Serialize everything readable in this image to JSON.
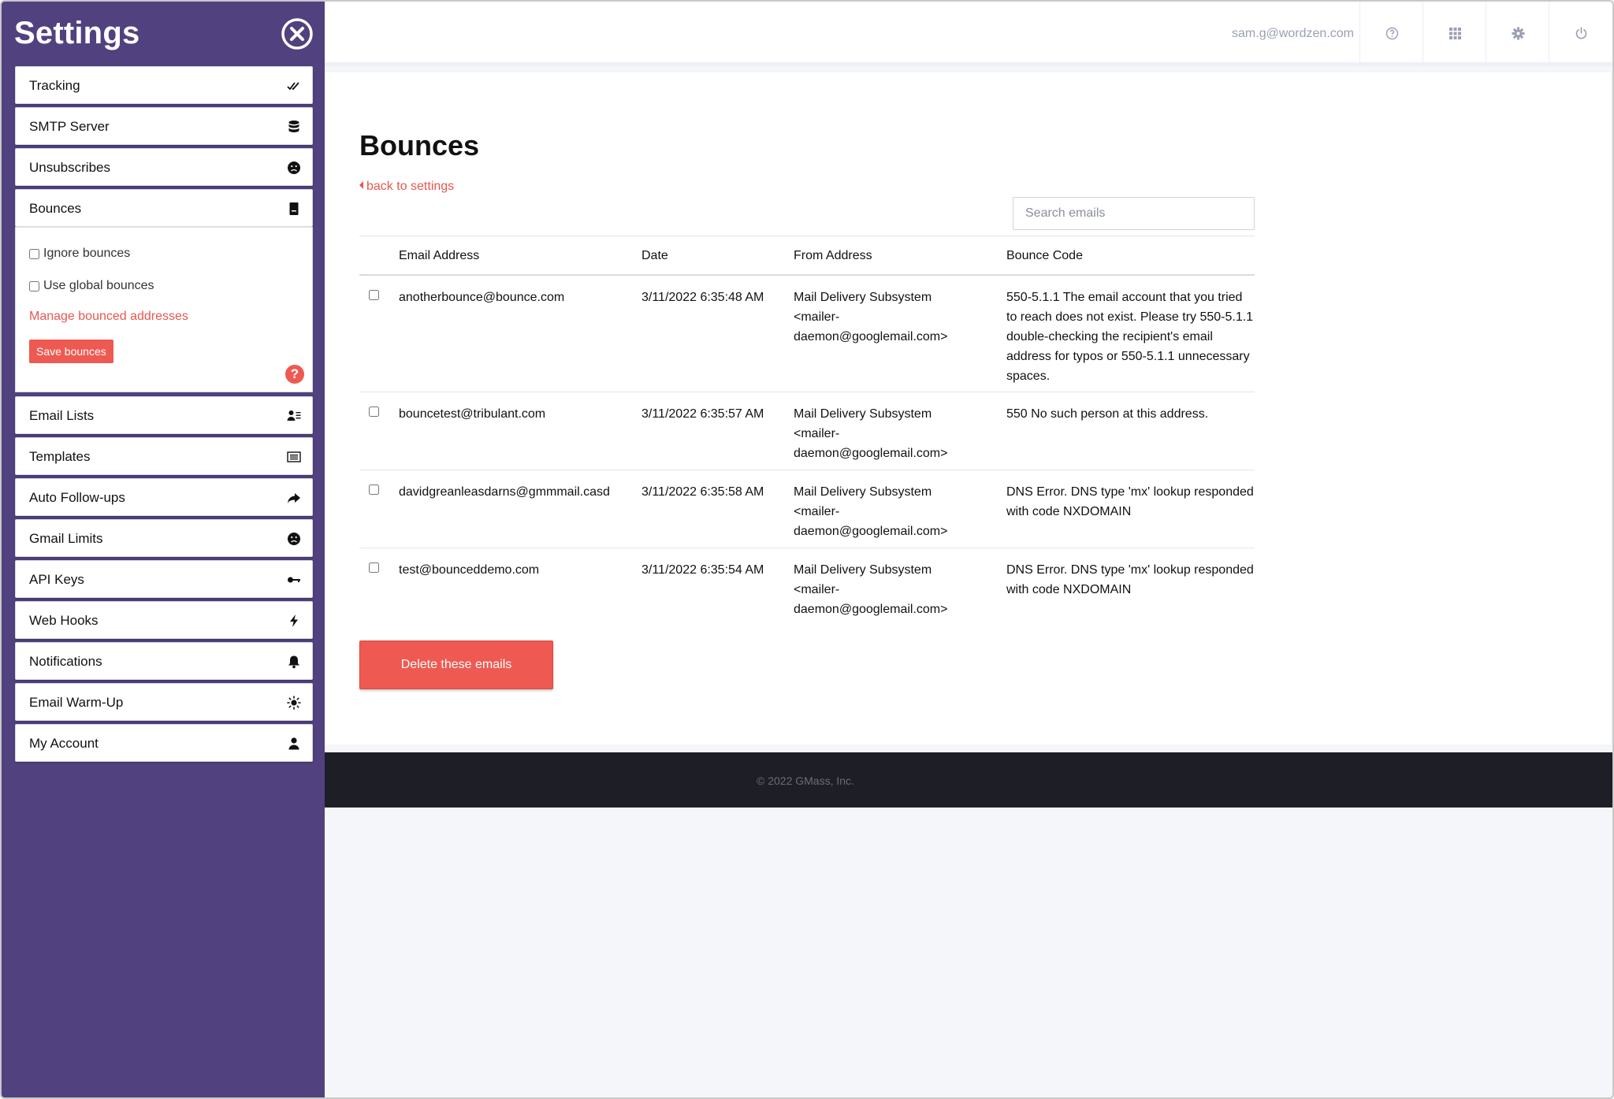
{
  "sidebar": {
    "title": "Settings",
    "items_before": [
      {
        "label": "Tracking",
        "icon": "double-check-icon"
      },
      {
        "label": "SMTP Server",
        "icon": "database-icon"
      },
      {
        "label": "Unsubscribes",
        "icon": "sad-face-icon"
      },
      {
        "label": "Bounces",
        "icon": "document-icon"
      }
    ],
    "bounces_panel": {
      "ignore_label": "Ignore bounces",
      "global_label": "Use global bounces",
      "manage_link": "Manage bounced addresses",
      "save_label": "Save bounces",
      "help_label": "?"
    },
    "items_after": [
      {
        "label": "Email Lists",
        "icon": "users-list-icon"
      },
      {
        "label": "Templates",
        "icon": "template-icon"
      },
      {
        "label": "Auto Follow-ups",
        "icon": "share-arrow-icon"
      },
      {
        "label": "Gmail Limits",
        "icon": "sad-face-icon"
      },
      {
        "label": "API Keys",
        "icon": "key-icon"
      },
      {
        "label": "Web Hooks",
        "icon": "lightning-icon"
      },
      {
        "label": "Notifications",
        "icon": "bell-icon"
      },
      {
        "label": "Email Warm-Up",
        "icon": "sun-icon"
      },
      {
        "label": "My Account",
        "icon": "user-icon"
      }
    ]
  },
  "topbar": {
    "user_email": "sam.g@wordzen.com",
    "icons": [
      "help-icon",
      "grid-icon",
      "gear-icon",
      "power-icon"
    ]
  },
  "main": {
    "title": "Bounces",
    "back_link": "back to settings",
    "search_placeholder": "Search emails",
    "columns": [
      "Email Address",
      "Date",
      "From Address",
      "Bounce Code"
    ],
    "rows": [
      {
        "email": "anotherbounce@bounce.com",
        "date": "3/11/2022 6:35:48 AM",
        "from": "Mail Delivery Subsystem <mailer-daemon@googlemail.com>",
        "code": "550-5.1.1 The email account that you tried to reach does not exist. Please try 550-5.1.1 double-checking the recipient's email address for typos or 550-5.1.1 unnecessary spaces."
      },
      {
        "email": "bouncetest@tribulant.com",
        "date": "3/11/2022 6:35:57 AM",
        "from": "Mail Delivery Subsystem <mailer-daemon@googlemail.com>",
        "code": "550 No such person at this address."
      },
      {
        "email": "davidgreanleasdarns@gmmmail.casd",
        "date": "3/11/2022 6:35:58 AM",
        "from": "Mail Delivery Subsystem <mailer-daemon@googlemail.com>",
        "code": "DNS Error. DNS type 'mx' lookup responded with code NXDOMAIN"
      },
      {
        "email": "test@bounceddemo.com",
        "date": "3/11/2022 6:35:54 AM",
        "from": "Mail Delivery Subsystem <mailer-daemon@googlemail.com>",
        "code": "DNS Error. DNS type 'mx' lookup responded with code NXDOMAIN"
      }
    ],
    "delete_label": "Delete these emails"
  },
  "footer": {
    "copyright": "© 2022 GMass, Inc."
  },
  "colors": {
    "sidebar_bg": "#51417f",
    "accent": "#ee5a52",
    "footer_bg": "#1d1e26"
  }
}
